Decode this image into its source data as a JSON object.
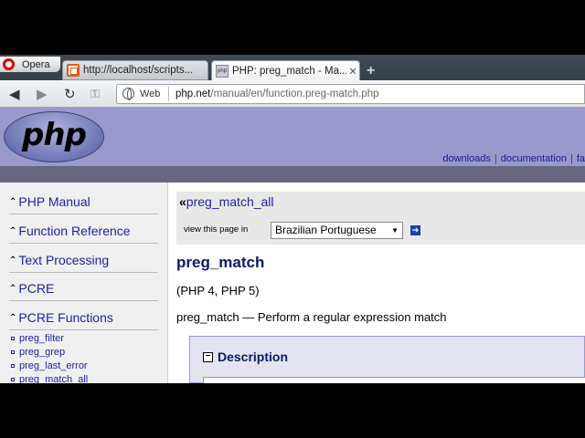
{
  "browser": {
    "menu_label": "Opera",
    "tabs": [
      {
        "label": "http://localhost/scripts..."
      },
      {
        "label": "PHP: preg_match - Ma..."
      }
    ],
    "newtab_glyph": "+",
    "address": {
      "zone_label": "Web",
      "url_host": "php.net",
      "url_path": "/manual/en/function.preg-match.php"
    }
  },
  "site": {
    "logo_text": "php",
    "top_links": [
      "downloads",
      "documentation",
      "fa"
    ]
  },
  "sidebar": {
    "sections": [
      {
        "label": "PHP Manual",
        "arrow": "⌃"
      },
      {
        "label": "Function Reference",
        "arrow": "⌃"
      },
      {
        "label": "Text Processing",
        "arrow": "⌃"
      },
      {
        "label": "PCRE",
        "arrow": "⌃"
      },
      {
        "label": "PCRE Functions",
        "arrow": "⌃"
      }
    ],
    "sub_items": [
      "preg_filter",
      "preg_grep",
      "preg_last_error",
      "preg_match_all"
    ]
  },
  "content": {
    "prev_marker": "«",
    "prev_link": "preg_match_all",
    "view_label": "view this page in",
    "language_selected": "Brazilian Portuguese",
    "function_name": "preg_match",
    "versions": "(PHP 4, PHP 5)",
    "summary": "preg_match — Perform a regular expression match",
    "description_heading": "Description"
  }
}
